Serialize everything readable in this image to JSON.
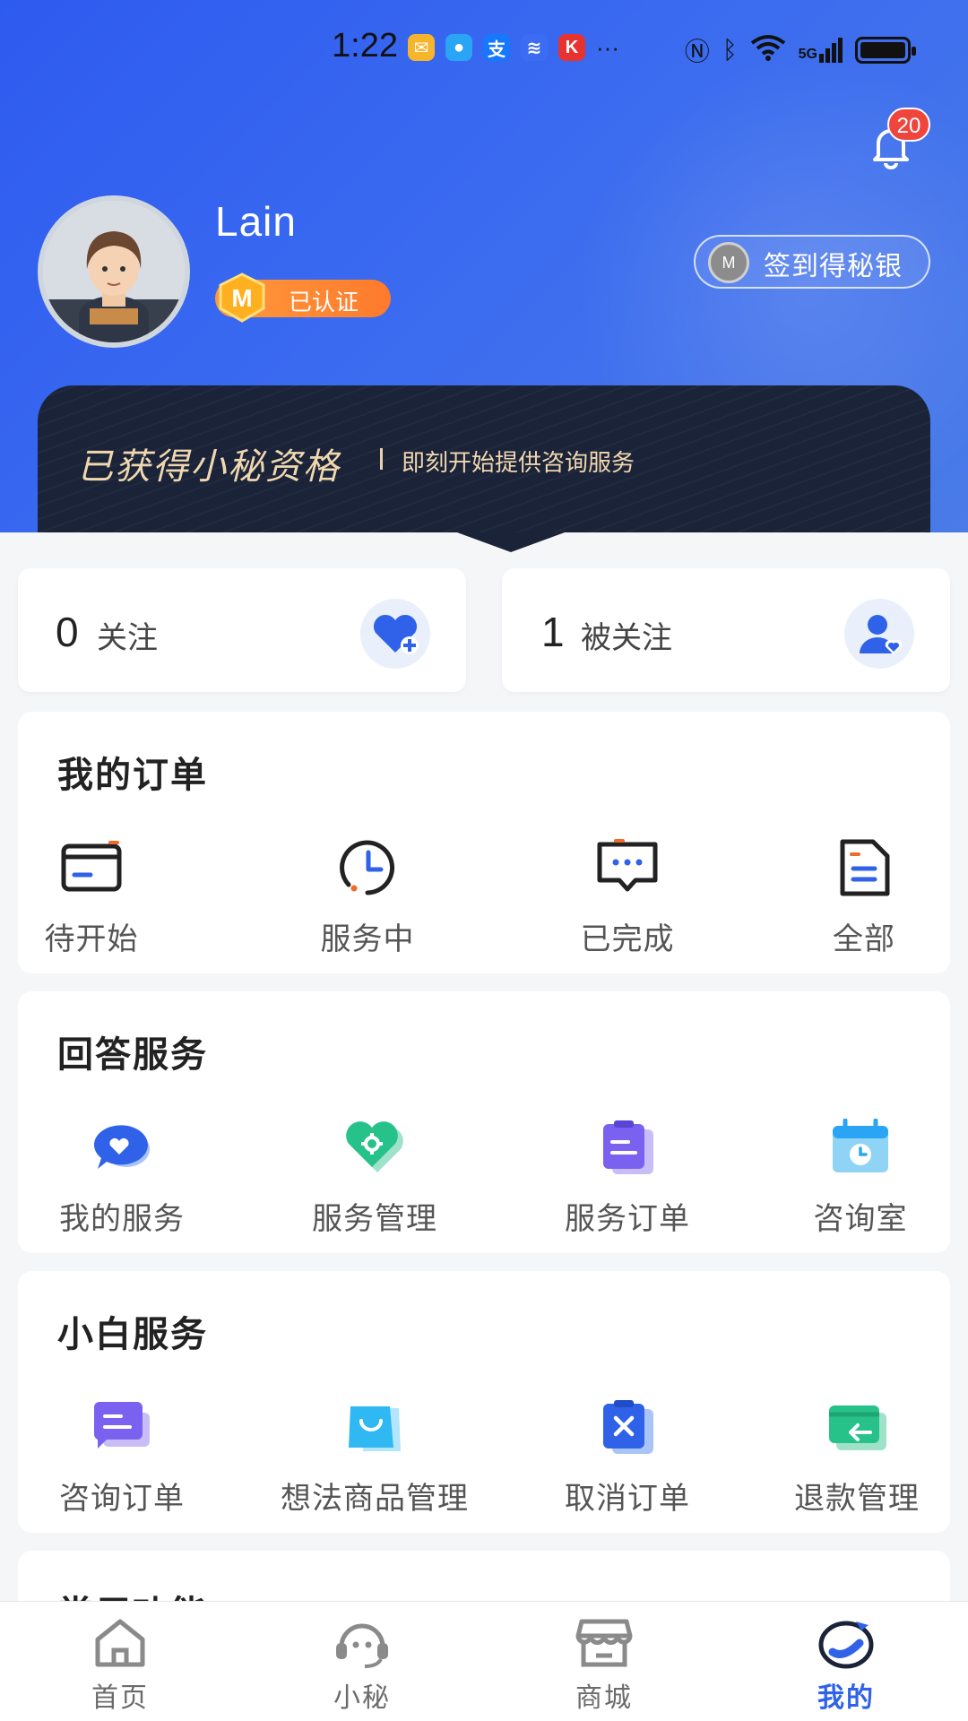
{
  "status_bar": {
    "time": "1:22",
    "dots": "···",
    "network": "5G"
  },
  "header": {
    "notifications_count": "20",
    "user_name": "Lain",
    "badge_letter": "M",
    "verified_label": "已认证",
    "coin_letter": "M",
    "signin_label": "签到得秘银",
    "qualification_title": "已获得小秘资格",
    "qualification_subtitle": "即刻开始提供咨询服务"
  },
  "follow": {
    "following_count": "0",
    "following_label": "关注",
    "followers_count": "1",
    "followers_label": "被关注"
  },
  "orders": {
    "title": "我的订单",
    "items": [
      {
        "label": "待开始",
        "icon": "card-icon"
      },
      {
        "label": "服务中",
        "icon": "clock-icon"
      },
      {
        "label": "已完成",
        "icon": "message-icon"
      },
      {
        "label": "全部",
        "icon": "document-icon"
      }
    ]
  },
  "answer_services": {
    "title": "回答服务",
    "items": [
      {
        "label": "我的服务",
        "icon": "heart-chat-icon"
      },
      {
        "label": "服务管理",
        "icon": "heart-gear-icon"
      },
      {
        "label": "服务订单",
        "icon": "clipboard-icon"
      },
      {
        "label": "咨询室",
        "icon": "calendar-clock-icon"
      }
    ]
  },
  "novice_services": {
    "title": "小白服务",
    "items": [
      {
        "label": "咨询订单",
        "icon": "chat-bubble-icon"
      },
      {
        "label": "想法商品管理",
        "icon": "shopping-bag-icon"
      },
      {
        "label": "取消订单",
        "icon": "clipboard-x-icon"
      },
      {
        "label": "退款管理",
        "icon": "wallet-return-icon"
      }
    ]
  },
  "common_section": {
    "title": "常用功能"
  },
  "tabbar": [
    {
      "label": "首页",
      "icon": "home-icon"
    },
    {
      "label": "小秘",
      "icon": "assistant-icon"
    },
    {
      "label": "商城",
      "icon": "store-icon"
    },
    {
      "label": "我的",
      "icon": "profile-icon",
      "active": true
    }
  ],
  "colors": {
    "primary": "#2f62e8",
    "header_gradient_start": "#2e5bef",
    "card_dark": "#1a2338",
    "badge_orange": "#ff8a33",
    "notification_red": "#f0453c"
  }
}
